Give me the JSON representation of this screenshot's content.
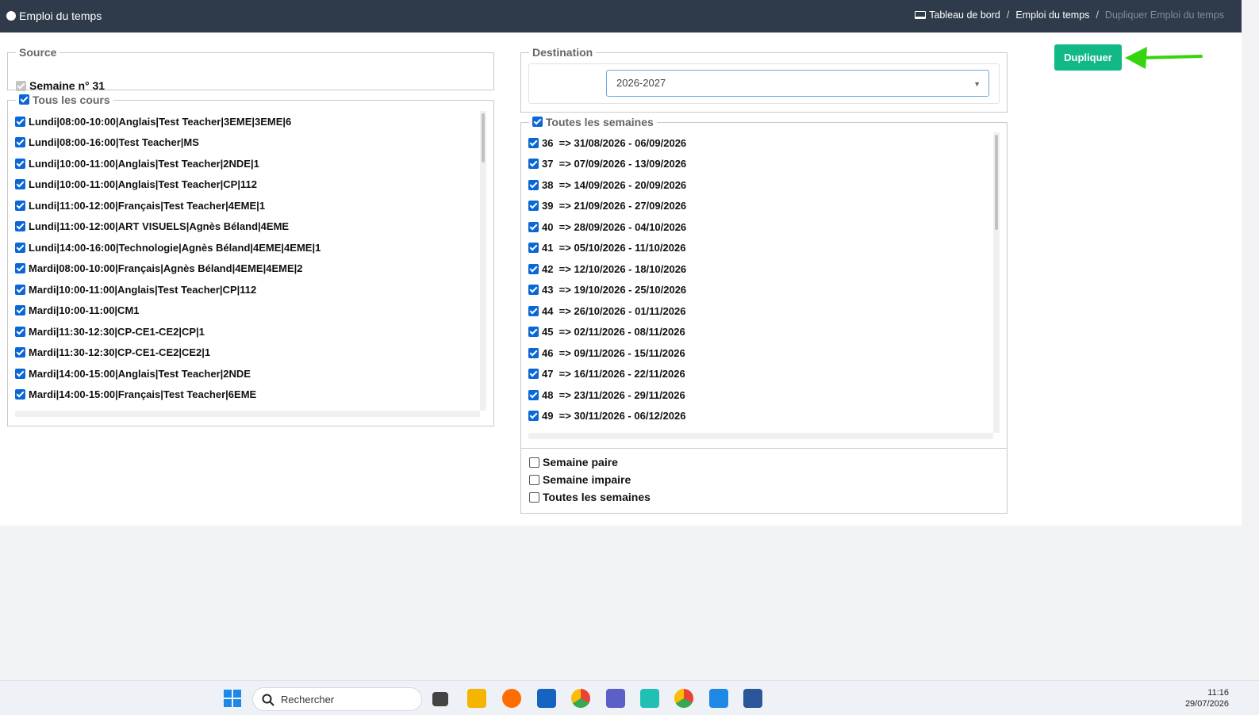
{
  "app": {
    "title": "Emploi du temps"
  },
  "breadcrumb": [
    "Tableau de bord",
    "Emploi du temps",
    "Dupliquer Emploi du temps"
  ],
  "source": {
    "legend": "Source",
    "week_label": "Semaine n° 31",
    "courses_legend": "Tous les cours",
    "courses": [
      "Lundi|08:00-10:00|Anglais|Test Teacher|3EME|3EME|6",
      "Lundi|08:00-16:00|Test Teacher|MS",
      "Lundi|10:00-11:00|Anglais|Test Teacher|2NDE|1",
      "Lundi|10:00-11:00|Anglais|Test Teacher|CP|112",
      "Lundi|11:00-12:00|Français|Test Teacher|4EME|1",
      "Lundi|11:00-12:00|ART VISUELS|Agnès Béland|4EME",
      "Lundi|14:00-16:00|Technologie|Agnès Béland|4EME|4EME|1",
      "Mardi|08:00-10:00|Français|Agnès Béland|4EME|4EME|2",
      "Mardi|10:00-11:00|Anglais|Test Teacher|CP|112",
      "Mardi|10:00-11:00|CM1",
      "Mardi|11:30-12:30|CP-CE1-CE2|CP|1",
      "Mardi|11:30-12:30|CP-CE1-CE2|CE2|1",
      "Mardi|14:00-15:00|Anglais|Test Teacher|2NDE",
      "Mardi|14:00-15:00|Français|Test Teacher|6EME"
    ]
  },
  "destination": {
    "legend": "Destination",
    "year_selected": "2026-2027",
    "weeks_legend": "Toutes les semaines",
    "weeks": [
      "36  => 31/08/2026 - 06/09/2026",
      "37  => 07/09/2026 - 13/09/2026",
      "38  => 14/09/2026 - 20/09/2026",
      "39  => 21/09/2026 - 27/09/2026",
      "40  => 28/09/2026 - 04/10/2026",
      "41  => 05/10/2026 - 11/10/2026",
      "42  => 12/10/2026 - 18/10/2026",
      "43  => 19/10/2026 - 25/10/2026",
      "44  => 26/10/2026 - 01/11/2026",
      "45  => 02/11/2026 - 08/11/2026",
      "46  => 09/11/2026 - 15/11/2026",
      "47  => 16/11/2026 - 22/11/2026",
      "48  => 23/11/2026 - 29/11/2026",
      "49  => 30/11/2026 - 06/12/2026"
    ],
    "options": [
      "Semaine paire",
      "Semaine impaire",
      "Toutes les semaines"
    ]
  },
  "actions": {
    "duplicate_label": "Dupliquer"
  },
  "colors": {
    "topbar": "#2f3b4a",
    "accent": "#12b886",
    "checkbox": "#0b67d6",
    "arrow": "#36d40f"
  },
  "taskbar": {
    "search_placeholder": "Rechercher",
    "time": "11:16",
    "date": "29/07/2026"
  }
}
